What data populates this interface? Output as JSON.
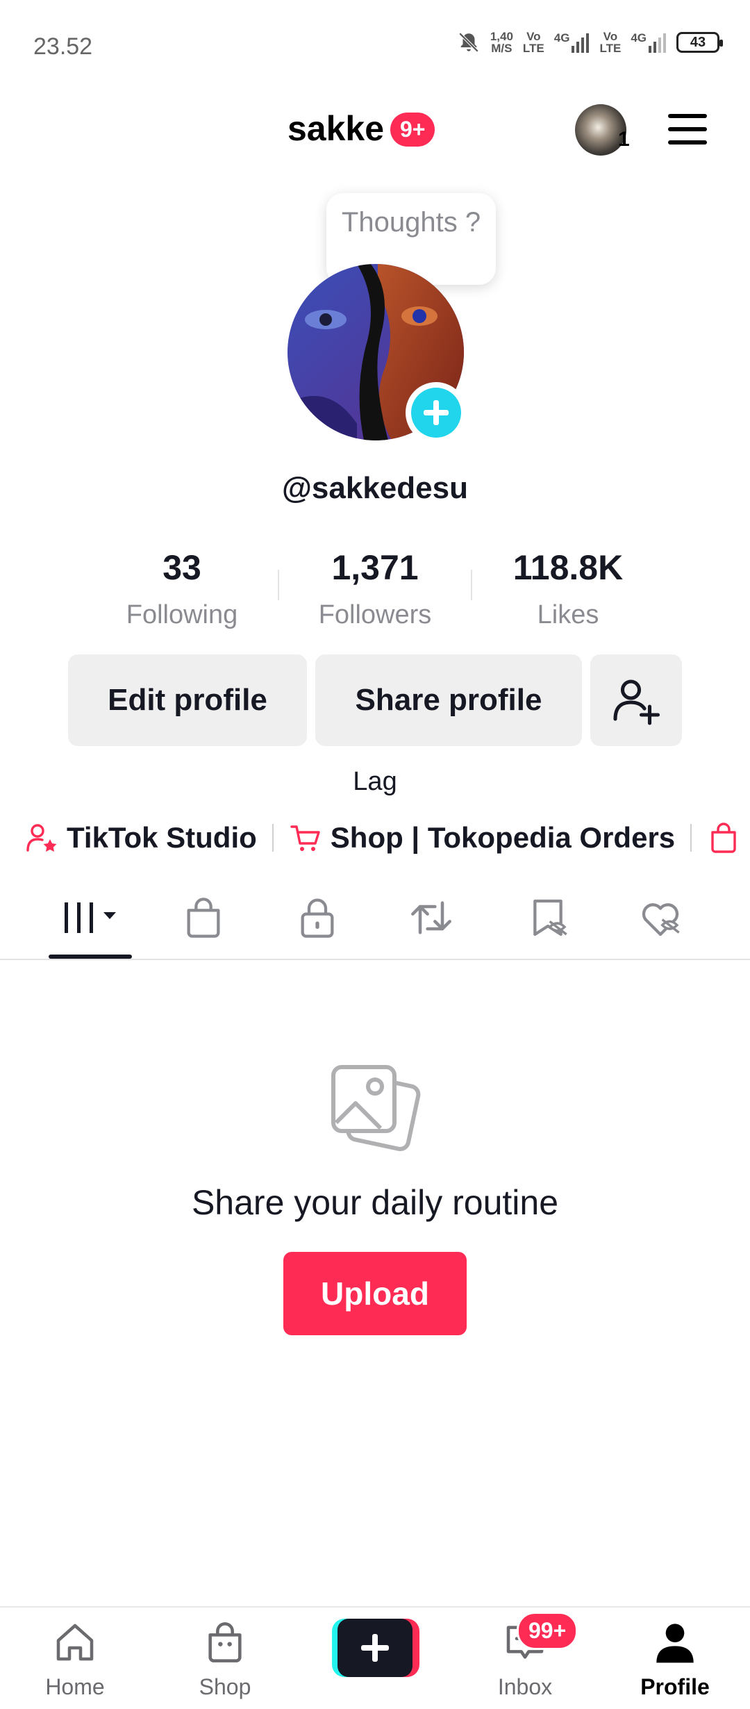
{
  "status_bar": {
    "time": "23.52",
    "speed_value": "1,40",
    "speed_unit": "M/S",
    "volte_1_top": "Vo",
    "volte_1_bottom": "LTE",
    "network_1": "4G",
    "volte_2_top": "Vo",
    "volte_2_bottom": "LTE",
    "network_2": "4G",
    "battery": "43"
  },
  "header": {
    "username": "sakke",
    "notification_badge": "9+",
    "avatar_count": "1"
  },
  "profile": {
    "thought_bubble": "Thoughts ?",
    "handle": "@sakkedesu",
    "bio": "Lag"
  },
  "stats": [
    {
      "value": "33",
      "label": "Following"
    },
    {
      "value": "1,371",
      "label": "Followers"
    },
    {
      "value": "118.8K",
      "label": "Likes"
    }
  ],
  "buttons": {
    "edit_profile": "Edit profile",
    "share_profile": "Share profile"
  },
  "links": {
    "studio": "TikTok Studio",
    "shop": "Shop | Tokopedia Orders"
  },
  "tabs": [
    "videos-grid-icon",
    "shop-bag-icon",
    "lock-icon",
    "repost-icon",
    "hidden-favorites-icon",
    "hidden-liked-icon"
  ],
  "empty_state": {
    "title": "Share your daily routine",
    "button": "Upload"
  },
  "bottom_nav": {
    "home": "Home",
    "shop": "Shop",
    "inbox": "Inbox",
    "inbox_badge": "99+",
    "profile": "Profile"
  },
  "colors": {
    "accent_red": "#fe2c55",
    "accent_cyan": "#20d5ec",
    "text_primary": "#161823",
    "text_secondary": "#8a8b91"
  }
}
